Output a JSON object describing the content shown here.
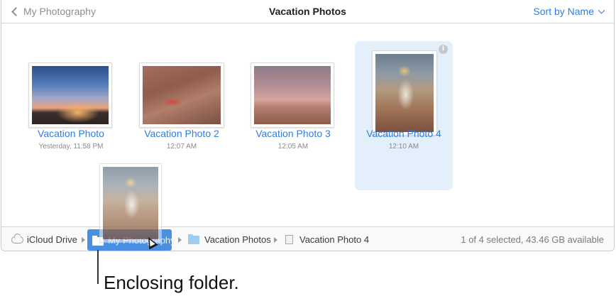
{
  "header": {
    "back_label": "My Photography",
    "title": "Vacation Photos",
    "sort_label": "Sort by Name"
  },
  "items": [
    {
      "name": "Vacation Photo",
      "date": "Yesterday, 11:58 PM"
    },
    {
      "name": "Vacation Photo 2",
      "date": "12:07 AM"
    },
    {
      "name": "Vacation Photo 3",
      "date": "12:05 AM"
    },
    {
      "name": "Vacation Photo 4",
      "date": "12:10 AM",
      "selected": true
    }
  ],
  "pathbar": {
    "segments": [
      "iCloud Drive",
      "My Photography",
      "Vacation Photos",
      "Vacation Photo 4"
    ],
    "status": "1 of 4 selected, 43.46 GB available"
  },
  "callout": "Enclosing folder.",
  "colors": {
    "accent": "#2f7ee0",
    "selection": "#e3f0fb",
    "drop_highlight": "#4a90e2"
  },
  "icons": {
    "back": "chevron-left-icon",
    "sort": "chevron-down-icon",
    "info": "info-icon",
    "icloud": "cloud-icon",
    "folder": "folder-icon",
    "file": "file-icon",
    "cursor": "pointer-cursor-icon"
  }
}
